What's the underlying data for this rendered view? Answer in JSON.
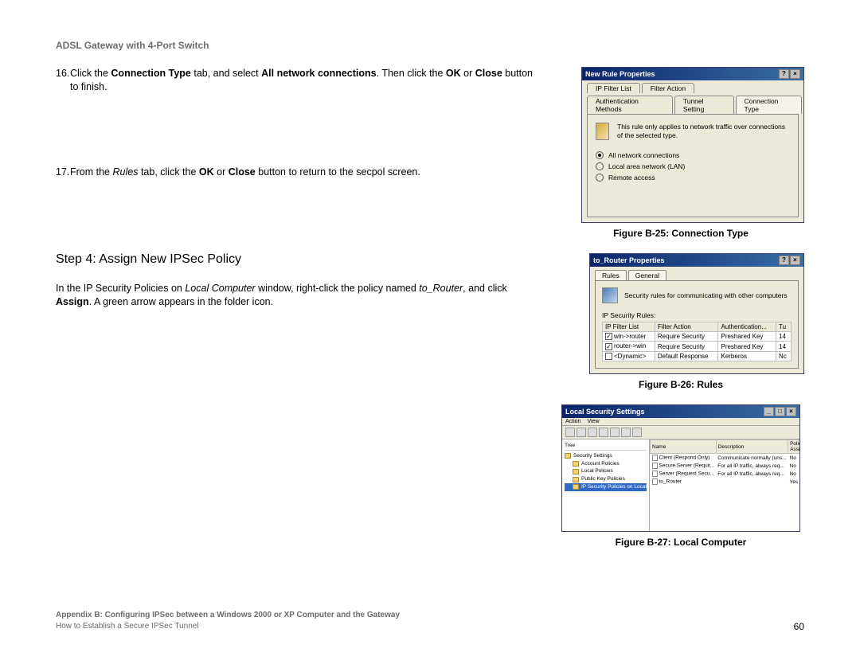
{
  "doc_title": "ADSL Gateway with 4-Port Switch",
  "step16": {
    "num": "16.",
    "t1": "Click the ",
    "b1": "Connection Type",
    "t2": " tab, and select ",
    "b2": "All network connections",
    "t3": ". Then click the ",
    "b3": "OK",
    "t4": " or ",
    "b4": "Close",
    "t5": " button to finish."
  },
  "step17": {
    "num": "17.",
    "t1": "From the ",
    "i1": "Rules",
    "t2": " tab, click the ",
    "b1": "OK",
    "t3": " or ",
    "b2": "Close",
    "t4": " button to return to the secpol screen."
  },
  "step4_heading": "Step 4: Assign New IPSec Policy",
  "step4_body": {
    "t1": "In the IP Security Policies on ",
    "i1": "Local Computer",
    "t2": " window, right-click the policy named ",
    "i2": "to_Router",
    "t3": ", and click ",
    "b1": "Assign",
    "t4": ". A green arrow appears in the folder icon."
  },
  "fig25": {
    "caption": "Figure B-25: Connection Type",
    "title": "New Rule Properties",
    "tabs1": [
      "IP Filter List",
      "Filter Action"
    ],
    "tabs2": [
      "Authentication Methods",
      "Tunnel Setting",
      "Connection Type"
    ],
    "desc": "This rule only applies to network traffic over connections of the selected type.",
    "radios": [
      {
        "label": "All network connections",
        "selected": true,
        "underline": "A"
      },
      {
        "label": "Local area network (LAN)",
        "selected": false,
        "underline": "L"
      },
      {
        "label": "Remote access",
        "selected": false,
        "underline": "R"
      }
    ]
  },
  "fig26": {
    "caption": "Figure B-26: Rules",
    "title": "to_Router Properties",
    "tabs": [
      "Rules",
      "General"
    ],
    "desc": "Security rules for communicating with other computers",
    "rules_label": "IP Security Rules:",
    "cols": [
      "IP Filter List",
      "Filter Action",
      "Authentication...",
      "Tu"
    ],
    "rows": [
      {
        "chk": true,
        "cells": [
          "win->router",
          "Require Security",
          "Preshared Key",
          "14"
        ]
      },
      {
        "chk": true,
        "cells": [
          "router->win",
          "Require Security",
          "Preshared Key",
          "14"
        ]
      },
      {
        "chk": false,
        "cells": [
          "<Dynamic>",
          "Default Response",
          "Kerberos",
          "Nc"
        ]
      }
    ]
  },
  "fig27": {
    "caption": "Figure B-27: Local Computer",
    "title": "Local Security Settings",
    "menus": [
      "Action",
      "View"
    ],
    "tree_label": "Tree",
    "tree": [
      {
        "label": "Security Settings",
        "indent": false,
        "sel": false
      },
      {
        "label": "Account Policies",
        "indent": true,
        "sel": false
      },
      {
        "label": "Local Policies",
        "indent": true,
        "sel": false
      },
      {
        "label": "Public Key Policies",
        "indent": true,
        "sel": false
      },
      {
        "label": "IP Security Policies on Local Machine",
        "indent": true,
        "sel": true
      }
    ],
    "cols": [
      "Name",
      "Description",
      "Policy Assigned"
    ],
    "rows": [
      [
        "Client (Respond Only)",
        "Communicate normally (uns...",
        "No"
      ],
      [
        "Secure Server (Requir...",
        "For all IP traffic, always req...",
        "No"
      ],
      [
        "Server (Request Secu...",
        "For all IP traffic, always req...",
        "No"
      ],
      [
        "to_Router",
        "",
        "Yes"
      ]
    ]
  },
  "footer": {
    "line1": "Appendix B: Configuring IPSec between a Windows 2000 or XP Computer and the Gateway",
    "line2": "How to Establish a Secure IPSec Tunnel",
    "page": "60"
  }
}
